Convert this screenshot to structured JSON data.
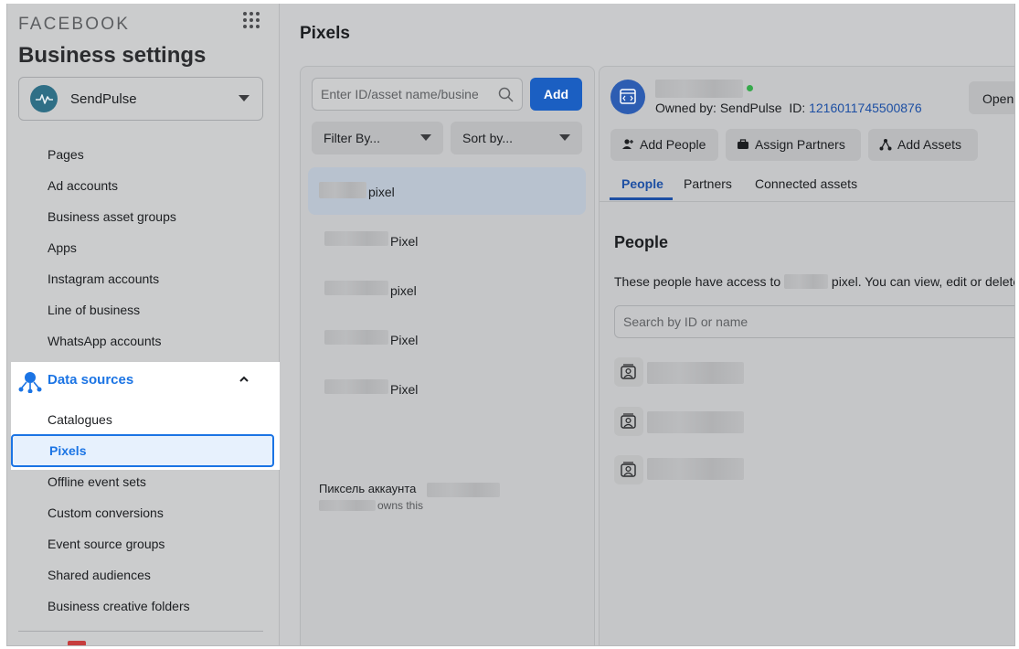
{
  "sidebar": {
    "brand": "FACEBOOK",
    "title": "Business settings",
    "account": {
      "name": "SendPulse"
    },
    "items_top": [
      "Pages",
      "Ad accounts",
      "Business asset groups",
      "Apps",
      "Instagram accounts",
      "Line of business",
      "WhatsApp accounts"
    ],
    "section": {
      "label": "Data sources"
    },
    "items_section": [
      "Catalogues",
      "Pixels",
      "Offline event sets",
      "Custom conversions",
      "Event source groups",
      "Shared audiences",
      "Business creative folders"
    ]
  },
  "main": {
    "title": "Pixels",
    "search": {
      "placeholder": "Enter ID/asset name/busine..."
    },
    "add_label": "Add",
    "filter_label": "Filter By...",
    "sort_label": "Sort by...",
    "pixel_rows": [
      "pixel",
      "Pixel",
      "pixel",
      "Pixel",
      "Pixel"
    ],
    "account_pixel": {
      "label": "Пиксель аккаунта",
      "owns": "owns this"
    }
  },
  "detail": {
    "owned_by_label": "Owned by: SendPulse",
    "id_label": "ID:",
    "id_value": "1216011745500876",
    "open_label": "Open",
    "actions": [
      "Add People",
      "Assign Partners",
      "Add Assets"
    ],
    "tabs": [
      "People",
      "Partners",
      "Connected assets"
    ],
    "active_tab": "People",
    "people_heading": "People",
    "people_desc_prefix": "These people have access to",
    "people_desc_suffix": "pixel. You can view, edit or delete",
    "people_search_placeholder": "Search by ID or name"
  },
  "colors": {
    "accent": "#1b74e4",
    "link": "#1d4fa3",
    "add_button": "#1b5fc2",
    "online": "#36a94b"
  }
}
